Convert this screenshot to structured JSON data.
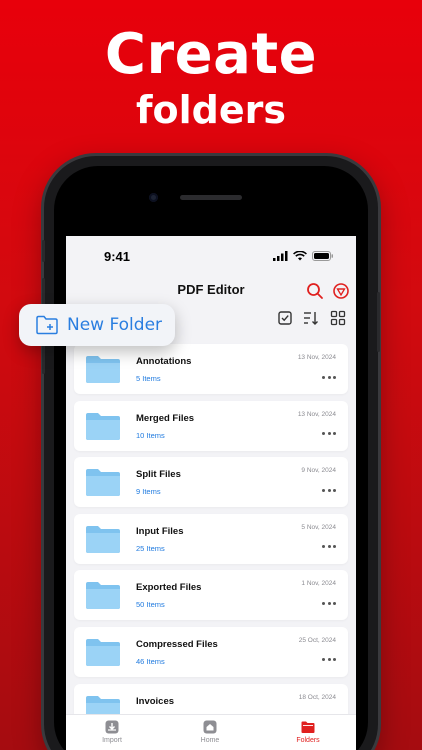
{
  "headline": {
    "line1": "Create",
    "line2": "folders"
  },
  "status_bar": {
    "time": "9:41"
  },
  "app": {
    "title": "PDF Editor",
    "accent": "#e0201f"
  },
  "popover": {
    "new_folder_label": "New Folder"
  },
  "folders": [
    {
      "name": "Annotations",
      "count": "5 Items",
      "date": "13 Nov, 2024"
    },
    {
      "name": "Merged Files",
      "count": "10 Items",
      "date": "13 Nov, 2024"
    },
    {
      "name": "Split Files",
      "count": "9 Items",
      "date": "9 Nov, 2024"
    },
    {
      "name": "Input Files",
      "count": "25 Items",
      "date": "5 Nov, 2024"
    },
    {
      "name": "Exported Files",
      "count": "50 Items",
      "date": "1 Nov, 2024"
    },
    {
      "name": "Compressed Files",
      "count": "46 Items",
      "date": "25 Oct, 2024"
    },
    {
      "name": "Invoices",
      "count": "",
      "date": "18 Oct, 2024"
    }
  ],
  "tabs": [
    {
      "label": "Import",
      "icon": "import-icon",
      "active": false
    },
    {
      "label": "Home",
      "icon": "home-icon",
      "active": false
    },
    {
      "label": "Folders",
      "icon": "folder-icon",
      "active": true
    }
  ]
}
